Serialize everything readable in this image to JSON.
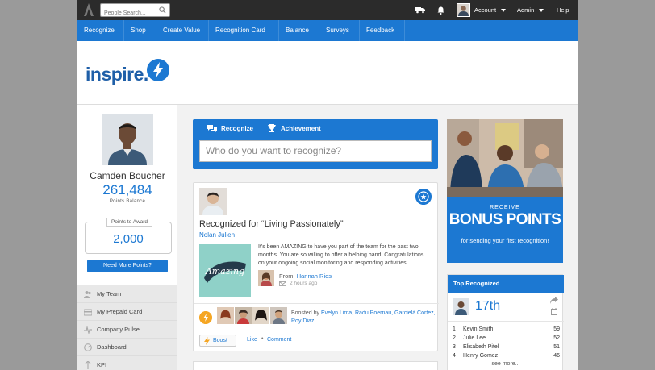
{
  "topbar": {
    "search_placeholder": "People Search...",
    "account_label": "Account",
    "admin_label": "Admin",
    "help_label": "Help"
  },
  "nav": {
    "items": [
      "Recognize",
      "Shop",
      "Create Value",
      "Recognition Card",
      "Balance",
      "Surveys",
      "Feedback"
    ]
  },
  "brand": {
    "name": "inspire."
  },
  "profile": {
    "name": "Camden Boucher",
    "balance": "261,484",
    "balance_label": "Points Balance",
    "award_label": "Points to Award",
    "award_value": "2,000",
    "need_points_label": "Need More Points?"
  },
  "side_menu": {
    "items": [
      "My Team",
      "My Prepaid Card",
      "Company Pulse",
      "Dashboard",
      "KPI"
    ]
  },
  "recognize_panel": {
    "tab_recognize": "Recognize",
    "tab_achievement": "Achievement",
    "input_placeholder": "Who do you want to recognize?"
  },
  "feed": {
    "title": "Recognized for “Living Passionately”",
    "person": "Nolan Julien",
    "image_text": "Amazing",
    "message": "It's been AMAZING to have you part of the team for the past two months. You are so willing to offer a helping hand. Congratulations on your ongoing social monitoring and responding activities.",
    "from_label": "From:",
    "from_name": "Hannah Rios",
    "time_ago": "2 hours ago",
    "boosted_label": "Boosted by",
    "boosted_names": "Evelyn Lima, Radu Poernau, Garcielá Cortez, Roy Diaz",
    "boost_button": "Boost",
    "like_label": "Like",
    "comment_label": "Comment"
  },
  "ad": {
    "small": "RECEIVE",
    "big": "BONUS POINTS",
    "sub": "for sending your first recognition!"
  },
  "top_recognized": {
    "title": "Top Recognized",
    "my_rank": "17th",
    "rows": [
      {
        "num": "1",
        "name": "Kevin Smith",
        "score": "59"
      },
      {
        "num": "2",
        "name": "Julie Lee",
        "score": "52"
      },
      {
        "num": "3",
        "name": "Elisabeth Pitel",
        "score": "51"
      },
      {
        "num": "4",
        "name": "Henry Gomez",
        "score": "46"
      }
    ],
    "more_label": "see more..."
  },
  "colors": {
    "primary": "#1c78d2",
    "topbar": "#2b2b2b",
    "boost": "#f5a623"
  }
}
